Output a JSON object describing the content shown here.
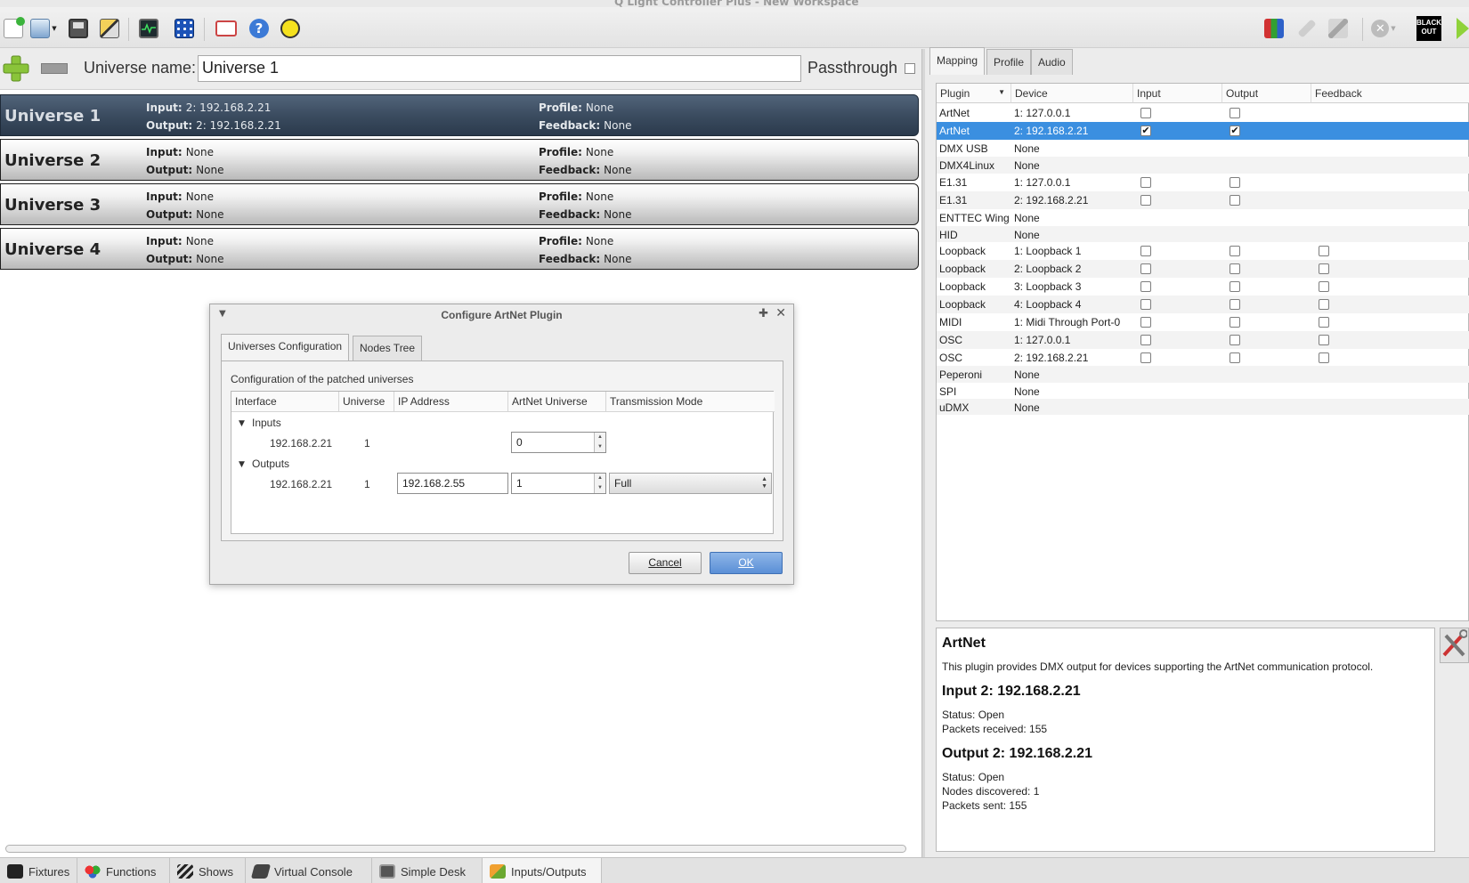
{
  "window": {
    "title": "Q Light Controller Plus - New Workspace"
  },
  "toolbar": {
    "left_icons": [
      "new-workspace-icon",
      "open-workspace-icon",
      "save-workspace-icon",
      "edit-mode-icon",
      "monitor-icon",
      "address-tool-icon",
      "fullscreen-icon",
      "help-icon",
      "about-icon"
    ],
    "right_icons": [
      "dmx-dump-icon",
      "live-edit-icon",
      "blackout-panel-icon",
      "stop-all-icon",
      "blackout-icon",
      "run-mode-icon"
    ],
    "blackout_label": "BLACK OUT"
  },
  "universe_bar": {
    "name_label": "Universe name:",
    "name_value": "Universe 1",
    "passthrough_label": "Passthrough"
  },
  "universes": [
    {
      "name": "Universe 1",
      "input_label": "Input:",
      "input": "2: 192.168.2.21",
      "output_label": "Output:",
      "output": "2: 192.168.2.21",
      "profile_label": "Profile:",
      "profile": "None",
      "feedback_label": "Feedback:",
      "feedback": "None"
    },
    {
      "name": "Universe 2",
      "input_label": "Input:",
      "input": "None",
      "output_label": "Output:",
      "output": "None",
      "profile_label": "Profile:",
      "profile": "None",
      "feedback_label": "Feedback:",
      "feedback": "None"
    },
    {
      "name": "Universe 3",
      "input_label": "Input:",
      "input": "None",
      "output_label": "Output:",
      "output": "None",
      "profile_label": "Profile:",
      "profile": "None",
      "feedback_label": "Feedback:",
      "feedback": "None"
    },
    {
      "name": "Universe 4",
      "input_label": "Input:",
      "input": "None",
      "output_label": "Output:",
      "output": "None",
      "profile_label": "Profile:",
      "profile": "None",
      "feedback_label": "Feedback:",
      "feedback": "None"
    }
  ],
  "dialog": {
    "title": "Configure ArtNet Plugin",
    "tabs": [
      "Universes Configuration",
      "Nodes Tree"
    ],
    "description": "Configuration of the patched universes",
    "columns": [
      "Interface",
      "Universe",
      "IP Address",
      "ArtNet Universe",
      "Transmission Mode"
    ],
    "inputs_label": "Inputs",
    "outputs_label": "Outputs",
    "input_row": {
      "interface": "192.168.2.21",
      "universe": "1",
      "artnet_universe": "0"
    },
    "output_row": {
      "interface": "192.168.2.21",
      "universe": "1",
      "ip": "192.168.2.55",
      "artnet_universe": "1",
      "mode": "Full"
    },
    "cancel_label": "Cancel",
    "ok_label": "OK"
  },
  "right_tabs": [
    "Mapping",
    "Profile",
    "Audio"
  ],
  "mapping": {
    "columns": [
      "Plugin",
      "Device",
      "Input",
      "Output",
      "Feedback"
    ],
    "rows": [
      {
        "plugin": "ArtNet",
        "device": "1: 127.0.0.1",
        "input": false,
        "output": false,
        "feedback": null
      },
      {
        "plugin": "ArtNet",
        "device": "2: 192.168.2.21",
        "input": true,
        "output": true,
        "feedback": null,
        "selected": true
      },
      {
        "plugin": "DMX USB",
        "device": "None",
        "input": null,
        "output": null,
        "feedback": null
      },
      {
        "plugin": "DMX4Linux",
        "device": "None",
        "input": null,
        "output": null,
        "feedback": null
      },
      {
        "plugin": "E1.31",
        "device": "1: 127.0.0.1",
        "input": false,
        "output": false,
        "feedback": null
      },
      {
        "plugin": "E1.31",
        "device": "2: 192.168.2.21",
        "input": false,
        "output": false,
        "feedback": null
      },
      {
        "plugin": "ENTTEC Wing",
        "device": "None",
        "input": null,
        "output": null,
        "feedback": null
      },
      {
        "plugin": "HID",
        "device": "None",
        "input": null,
        "output": null,
        "feedback": null
      },
      {
        "plugin": "Loopback",
        "device": "1: Loopback 1",
        "input": false,
        "output": false,
        "feedback": false
      },
      {
        "plugin": "Loopback",
        "device": "2: Loopback 2",
        "input": false,
        "output": false,
        "feedback": false
      },
      {
        "plugin": "Loopback",
        "device": "3: Loopback 3",
        "input": false,
        "output": false,
        "feedback": false
      },
      {
        "plugin": "Loopback",
        "device": "4: Loopback 4",
        "input": false,
        "output": false,
        "feedback": false
      },
      {
        "plugin": "MIDI",
        "device": "1: Midi Through Port-0",
        "input": false,
        "output": false,
        "feedback": false
      },
      {
        "plugin": "OSC",
        "device": "1: 127.0.0.1",
        "input": false,
        "output": false,
        "feedback": false
      },
      {
        "plugin": "OSC",
        "device": "2: 192.168.2.21",
        "input": false,
        "output": false,
        "feedback": false
      },
      {
        "plugin": "Peperoni",
        "device": "None",
        "input": null,
        "output": null,
        "feedback": null
      },
      {
        "plugin": "SPI",
        "device": "None",
        "input": null,
        "output": null,
        "feedback": null
      },
      {
        "plugin": "uDMX",
        "device": "None",
        "input": null,
        "output": null,
        "feedback": null
      }
    ]
  },
  "info": {
    "title": "ArtNet",
    "description": "This plugin provides DMX output for devices supporting the ArtNet communication protocol.",
    "input_title": "Input 2: 192.168.2.21",
    "input_status": "Status: Open",
    "input_packets": "Packets received: 155",
    "output_title": "Output 2: 192.168.2.21",
    "output_status": "Status: Open",
    "output_nodes": "Nodes discovered: 1",
    "output_packets": "Packets sent: 155"
  },
  "bottom_tabs": [
    "Fixtures",
    "Functions",
    "Shows",
    "Virtual Console",
    "Simple Desk",
    "Inputs/Outputs"
  ],
  "colors": {
    "selected_row": "#3b8fe0",
    "selected_universe": "#3b4c60",
    "ok_button": "#5a8fd6"
  }
}
